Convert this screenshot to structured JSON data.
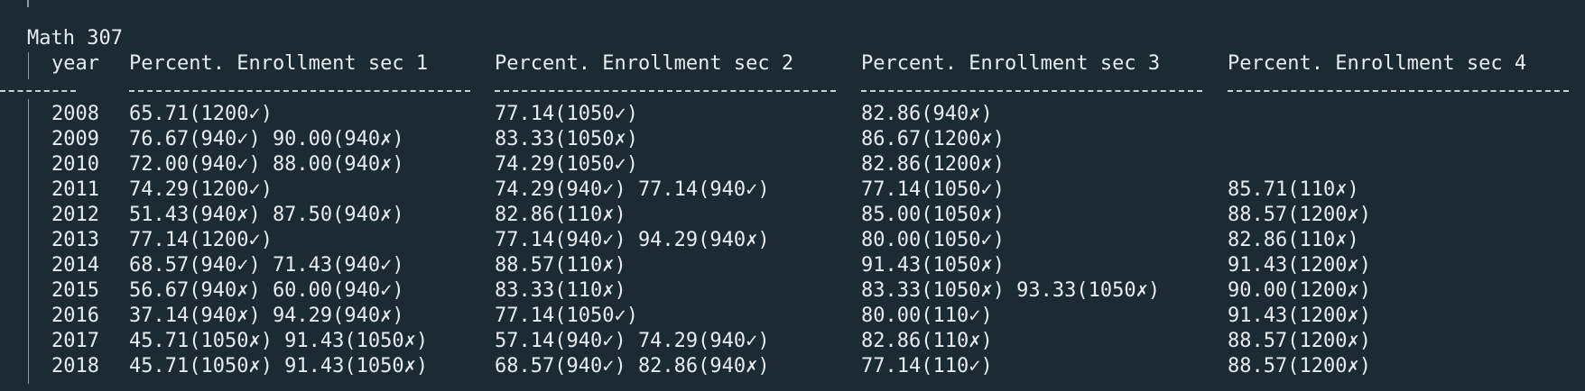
{
  "title": "Math 307",
  "headers": {
    "year": "year",
    "sec1": "Percent. Enrollment sec 1",
    "sec2": "Percent. Enrollment sec 2",
    "sec3": "Percent. Enrollment sec 3",
    "sec4": "Percent. Enrollment sec 4"
  },
  "rows": [
    {
      "year": "2008",
      "sec1": "65.71(1200✓)",
      "sec2": "77.14(1050✓)",
      "sec3": "82.86(940✗)",
      "sec4": ""
    },
    {
      "year": "2009",
      "sec1": "76.67(940✓) 90.00(940✗)",
      "sec2": "83.33(1050✗)",
      "sec3": "86.67(1200✗)",
      "sec4": ""
    },
    {
      "year": "2010",
      "sec1": "72.00(940✓) 88.00(940✗)",
      "sec2": "74.29(1050✓)",
      "sec3": "82.86(1200✗)",
      "sec4": ""
    },
    {
      "year": "2011",
      "sec1": "74.29(1200✓)",
      "sec2": "74.29(940✓) 77.14(940✓)",
      "sec3": "77.14(1050✓)",
      "sec4": "85.71(110✗)"
    },
    {
      "year": "2012",
      "sec1": "51.43(940✗) 87.50(940✗)",
      "sec2": "82.86(110✗)",
      "sec3": "85.00(1050✗)",
      "sec4": "88.57(1200✗)"
    },
    {
      "year": "2013",
      "sec1": "77.14(1200✓)",
      "sec2": "77.14(940✓) 94.29(940✗)",
      "sec3": "80.00(1050✓)",
      "sec4": "82.86(110✗)"
    },
    {
      "year": "2014",
      "sec1": "68.57(940✓) 71.43(940✓)",
      "sec2": "88.57(110✗)",
      "sec3": "91.43(1050✗)",
      "sec4": "91.43(1200✗)"
    },
    {
      "year": "2015",
      "sec1": "56.67(940✗) 60.00(940✓)",
      "sec2": "83.33(110✗)",
      "sec3": "83.33(1050✗) 93.33(1050✗)",
      "sec4": "90.00(1200✗)"
    },
    {
      "year": "2016",
      "sec1": "37.14(940✗) 94.29(940✗)",
      "sec2": "77.14(1050✓)",
      "sec3": "80.00(110✓)",
      "sec4": "91.43(1200✗)"
    },
    {
      "year": "2017",
      "sec1": "45.71(1050✗) 91.43(1050✗)",
      "sec2": "57.14(940✓) 74.29(940✓)",
      "sec3": "82.86(110✗)",
      "sec4": "88.57(1200✗)"
    },
    {
      "year": "2018",
      "sec1": "45.71(1050✗) 91.43(1050✗)",
      "sec2": "68.57(940✓) 82.86(940✗)",
      "sec3": "77.14(110✓)",
      "sec4": "88.57(1200✗)"
    }
  ],
  "colors": {
    "background": "#1c2a34",
    "text": "#e6ecef",
    "gutter": "#8e9aa2"
  }
}
